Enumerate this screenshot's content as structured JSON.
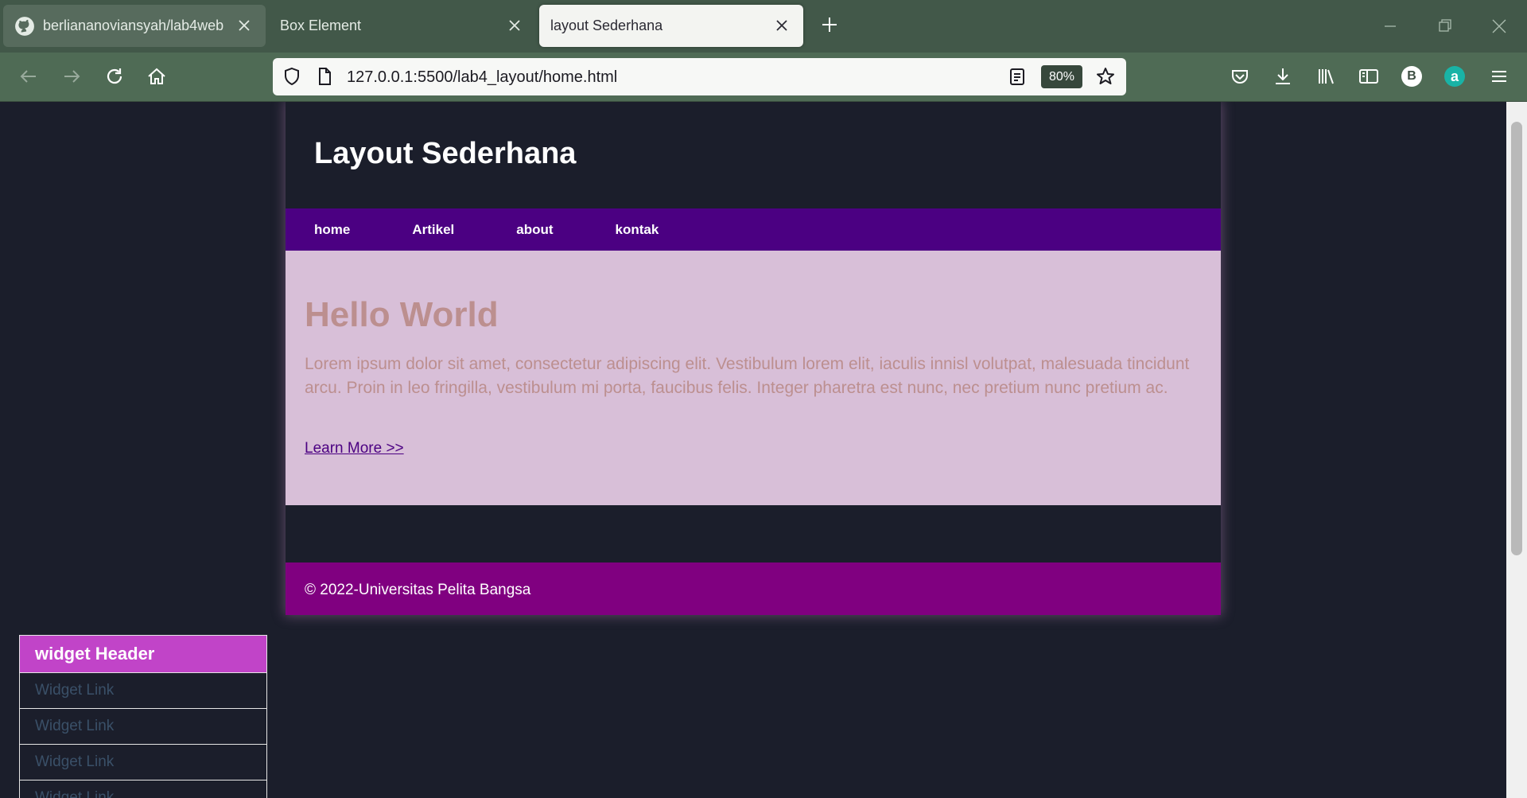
{
  "browser": {
    "tabs": [
      {
        "label": "berliananoviansyah/lab4web",
        "icon": "github-icon"
      },
      {
        "label": "Box Element"
      },
      {
        "label": "layout Sederhana",
        "active": true
      }
    ],
    "url": "127.0.0.1:5500/lab4_layout/home.html",
    "zoom": "80%",
    "profile_initial": "B",
    "extension_initial": "a"
  },
  "site": {
    "title": "Layout Sederhana",
    "nav": [
      "home",
      "Artikel",
      "about",
      "kontak"
    ],
    "hero": {
      "heading": "Hello World",
      "body": "Lorem ipsum dolor sit amet, consectetur adipiscing elit. Vestibulum lorem elit, iaculis innisl volutpat, malesuada tincidunt arcu. Proin in leo fringilla, vestibulum mi porta, faucibus felis. Integer pharetra est nunc, nec pretium nunc pretium ac.",
      "link": "Learn More >>"
    },
    "footer": "© 2022-Universitas Pelita Bangsa",
    "widget": {
      "header": "widget Header",
      "links": [
        "Widget Link",
        "Widget Link",
        "Widget Link",
        "Widget Link"
      ]
    }
  },
  "colors": {
    "tabbar": "#425849",
    "toolbar": "#4f6b55",
    "page_bg": "#1b1e2b",
    "nav": "#4b0082",
    "hero": "#d8bfd8",
    "hero_text": "#bc8f8f",
    "footer": "#800080",
    "widget_header": "#c144c8"
  }
}
